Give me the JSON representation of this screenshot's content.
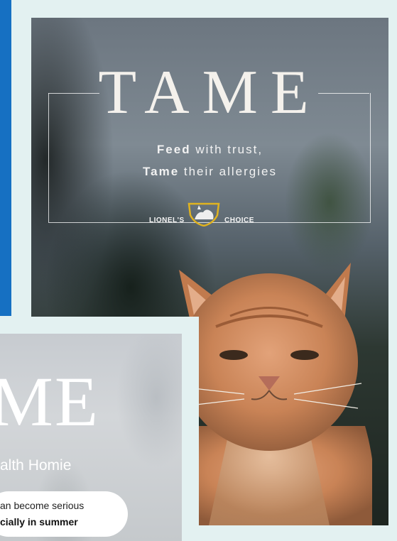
{
  "poster": {
    "title": "TAME",
    "tagline_line1_bold": "Feed",
    "tagline_line1_rest": " with trust,",
    "tagline_line2_bold": "Tame",
    "tagline_line2_rest": " their allergies",
    "logo_left": "LIONEL'S",
    "logo_right": "CHOICE"
  },
  "card2": {
    "title_fragment": "ME",
    "subtitle_fragment": "alth Homie",
    "pill_line1": "an become serious",
    "pill_line2": "cially in summer"
  },
  "colors": {
    "background": "#e3f1f1",
    "accent_bar": "#1670c2",
    "logo_shield": "#e0b320"
  }
}
